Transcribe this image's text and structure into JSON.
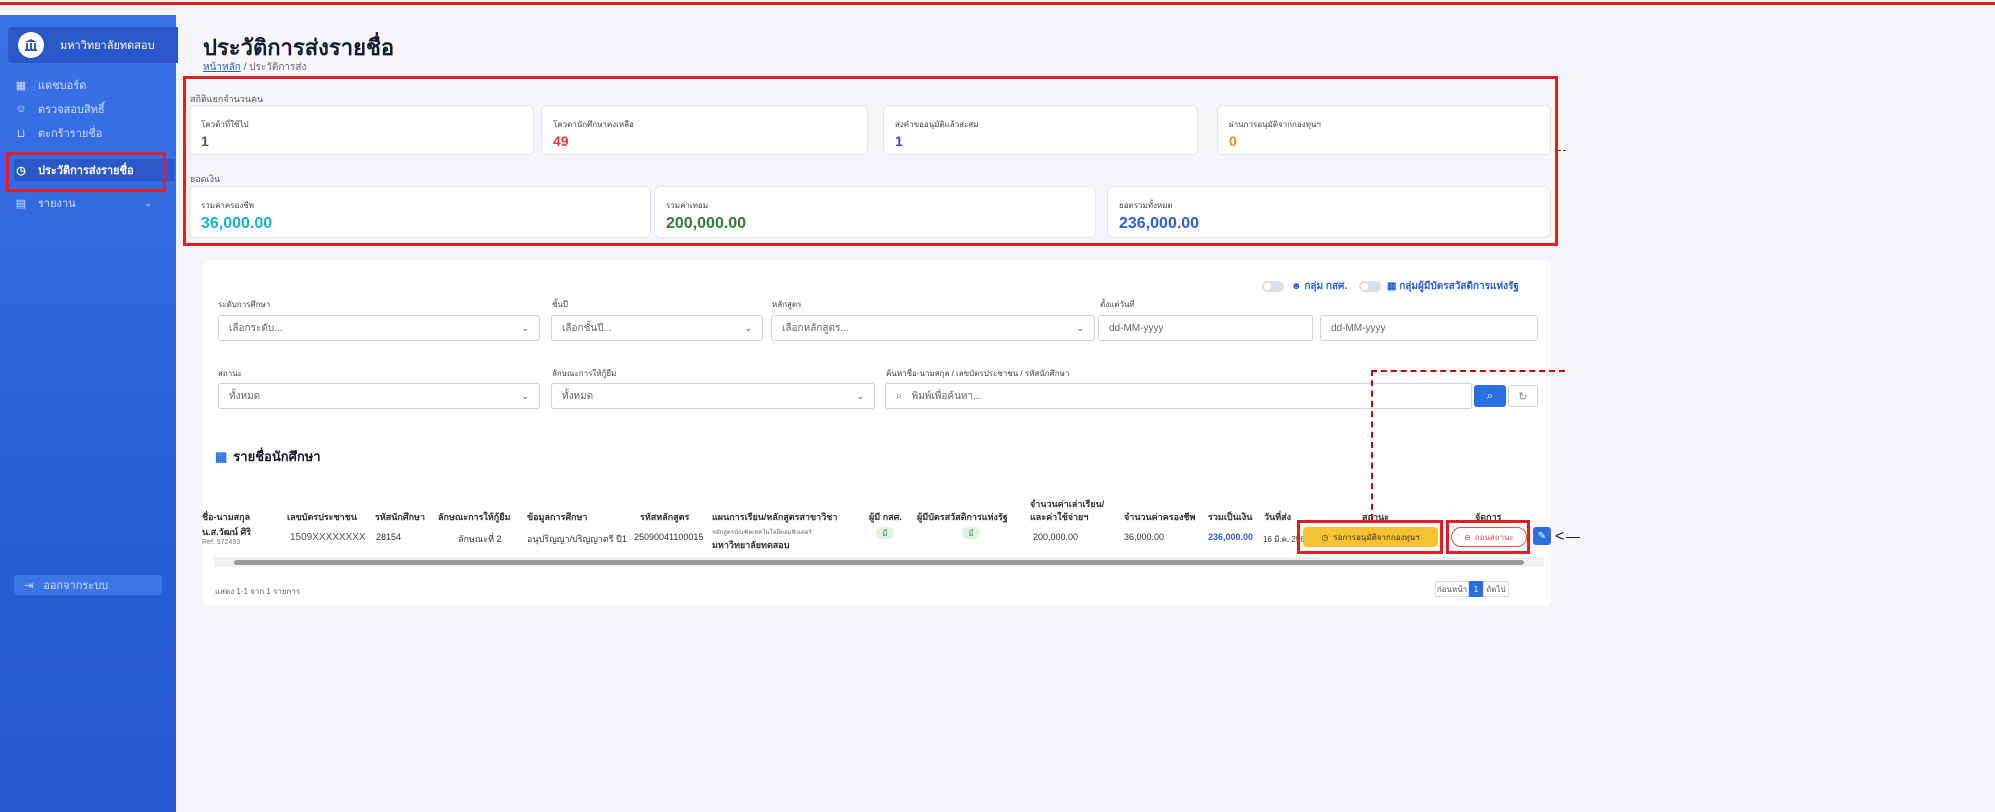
{
  "sidebar": {
    "brand": "มหาวิทยาลัยทดสอบ",
    "items": [
      {
        "label": "แดชบอร์ด",
        "icon": "dashboard-icon"
      },
      {
        "label": "ตรวจสอบสิทธิ์",
        "icon": "user-check-icon"
      },
      {
        "label": "ตะกร้ารายชื่อ",
        "icon": "basket-icon"
      },
      {
        "label": "ประวัติการส่งรายชื่อ",
        "icon": "history-icon"
      },
      {
        "label": "รายงาน",
        "icon": "report-icon"
      }
    ],
    "logout": "ออกจากระบบ"
  },
  "header": {
    "title": "ประวัติการส่งรายชื่อ",
    "breadcrumb_home": "หน้าหลัก",
    "breadcrumb_current": "/ ประวัติการส่ง"
  },
  "stats": {
    "people_label": "สถิติแยกจำนวนคน",
    "cards": [
      {
        "label": "โควต้าที่ใช้ไป",
        "value": "1",
        "color": "#555555"
      },
      {
        "label": "โควตานักศึกษาคงเหลือ",
        "value": "49",
        "color": "#e23b3b"
      },
      {
        "label": "ส่งคำขออนุมัติแล้วสะสม",
        "value": "1",
        "color": "#5a3fc0"
      },
      {
        "label": "ผ่านการอนุมัติจากกองทุนฯ",
        "value": "0",
        "color": "#f08a1c"
      }
    ],
    "money_label": "ยอดเงิน",
    "money": [
      {
        "label": "รวมค่าครองชีพ",
        "value": "36,000.00",
        "color": "#16b3c7"
      },
      {
        "label": "รวมค่าเทอม",
        "value": "200,000.00",
        "color": "#2e7d32"
      },
      {
        "label": "ยอดรวมทั้งหมด",
        "value": "236,000.00",
        "color": "#2a5fd6"
      }
    ]
  },
  "filters": {
    "toggle1": "กลุ่ม กสศ.",
    "toggle2": "กลุ่มผู้มีบัตรสวัสดิการแห่งรัฐ",
    "level_label": "ระดับการศึกษา",
    "level_placeholder": "เลือกระดับ...",
    "year_label": "ชั้นปี",
    "year_placeholder": "เลือกชั้นปี...",
    "course_label": "หลักสูตร",
    "course_placeholder": "เลือกหลักสูตร...",
    "date_label": "ตั้งแต่วันที่",
    "date_from": "dd-MM-yyyy",
    "date_to": "dd-MM-yyyy",
    "status_label": "สถานะ",
    "status_value": "ทั้งหมด",
    "loan_label": "ลักษณะการให้กู้ยืม",
    "loan_value": "ทั้งหมด",
    "search_label": "ค้นหาชื่อ-นามสกุล / เลขบัตรประชาชน / รหัสนักศึกษา",
    "search_placeholder": "พิมพ์เพื่อค้นหา..."
  },
  "table": {
    "title": "รายชื่อนักศึกษา",
    "headers": [
      "ชื่อ-นามสกุล",
      "เลขบัตรประชาชน",
      "รหัสนักศึกษา",
      "ลักษณะการให้กู้ยืม",
      "ข้อมูลการศึกษา",
      "รหัสหลักสูตร",
      "แผนการเรียน/หลักสูตรสาขาวิชา",
      "ผู้มี กสศ.",
      "ผู้มีบัตรสวัสดิการแห่งรัฐ",
      "จำนวนค่าเล่าเรียน/",
      "และค่าใช้จ่ายฯ",
      "จำนวนค่าครองชีพ",
      "รวมเป็นเงิน",
      "วันที่ส่ง",
      "สถานะ",
      "จัดการ"
    ],
    "row": {
      "name": "น.ส.วัฒน์ ศิริ",
      "ref": "Ref: 972493",
      "id_card": "1509XXXXXXXX",
      "student_id": "28154",
      "loan_type": "ลักษณะที่ 2",
      "education": "อนุปริญญา/ปริญญาตรี ปี1",
      "course_code": "25090041100015",
      "plan_line1": "หลักสูตรบัณฑิตเทคโนโลยีคอมพิวเตอร์",
      "plan_line2": "มหาวิทยาลัยทดสอบ",
      "eef": "มี",
      "welfare": "มี",
      "tuition": "200,000.00",
      "living": "36,000.00",
      "total": "236,000.00",
      "date": "16 มี.ค. 2569",
      "status": "รอการอนุมัติจากกองทุนฯ",
      "cancel": "ถอนสถานะ"
    },
    "footer": "แสดง 1-1 จาก 1 รายการ",
    "prev": "ก่อนหน้า",
    "page": "1",
    "next": "ถัดไป"
  }
}
